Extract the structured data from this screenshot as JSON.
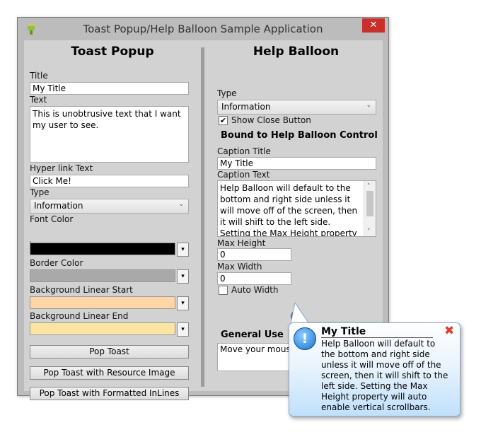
{
  "window": {
    "title": "Toast Popup/Help Balloon Sample Application",
    "close_glyph": "✕"
  },
  "toast": {
    "heading": "Toast Popup",
    "title_label": "Title",
    "title_value": "My Title",
    "text_label": "Text",
    "text_value": "This is unobtrusive text that I want my user to see.",
    "hyperlink_label": "Hyper link Text",
    "hyperlink_value": "Click Me!",
    "type_label": "Type",
    "type_value": "Information",
    "font_color_label": "Font Color",
    "border_color_label": "Border Color",
    "bg_start_label": "Background Linear Start",
    "bg_end_label": "Background Linear End",
    "btn_pop": "Pop Toast",
    "btn_pop_image": "Pop Toast with Resource Image",
    "btn_pop_inlines": "Pop Toast with Formatted InLines",
    "colors": {
      "font": "#000000",
      "border": "#a9a9a9",
      "bg_start": "#fdd5a6",
      "bg_end": "#fbe4a3"
    }
  },
  "help": {
    "heading": "Help Balloon",
    "type_label": "Type",
    "type_value": "Information",
    "show_close_label": "Show Close Button",
    "bound_heading": "Bound to Help Balloon Control",
    "caption_title_label": "Caption Title",
    "caption_title_value": "My Title",
    "caption_text_label": "Caption Text",
    "caption_text_value": "Help Balloon will default to the bottom and right side unless it will move off of the screen, then it will shift to the left side.  Setting the Max Height property will auto enable",
    "max_height_label": "Max Height",
    "max_height_value": "0",
    "max_width_label": "Max Width",
    "max_width_value": "0",
    "auto_width_label": "Auto Width",
    "general_heading": "General Use",
    "general_value": "Move your mouse over this"
  },
  "balloon": {
    "title": "My Title",
    "text": "Help Balloon will default to the bottom and right side unless it will move off of the screen, then it will shift to the left side. Setting the Max Height property will auto enable vertical scrollbars.",
    "close_glyph": "✖"
  },
  "glyphs": {
    "chevron": "⌄",
    "dropdown": "▾",
    "check": "✔",
    "info": "!"
  }
}
